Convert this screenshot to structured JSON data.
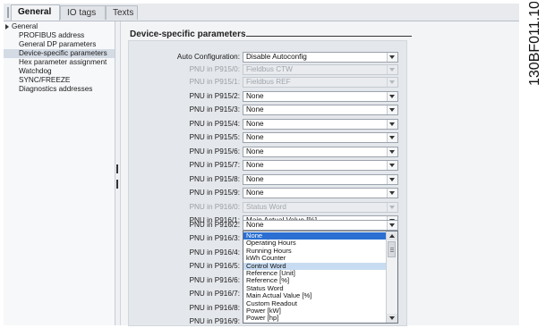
{
  "tabs": [
    {
      "label": "General",
      "active": true
    },
    {
      "label": "IO tags",
      "active": false
    },
    {
      "label": "Texts",
      "active": false
    }
  ],
  "nav": {
    "items": [
      {
        "label": "General",
        "root": true,
        "selected": false
      },
      {
        "label": "PROFIBUS address",
        "root": false,
        "selected": false
      },
      {
        "label": "General DP parameters",
        "root": false,
        "selected": false
      },
      {
        "label": "Device-specific parameters",
        "root": false,
        "selected": true
      },
      {
        "label": "Hex parameter assignment",
        "root": false,
        "selected": false
      },
      {
        "label": "Watchdog",
        "root": false,
        "selected": false
      },
      {
        "label": "SYNC/FREEZE",
        "root": false,
        "selected": false
      },
      {
        "label": "Diagnostics addresses",
        "root": false,
        "selected": false
      }
    ]
  },
  "section": {
    "title": "Device-specific parameters"
  },
  "rows": [
    {
      "label": "Auto Configuration:",
      "value": "Disable Autoconfig",
      "disabled": false
    },
    {
      "label": "PNU in P915/0:",
      "value": "Fieldbus CTW",
      "disabled": true
    },
    {
      "label": "PNU in P915/1:",
      "value": "Fieldbus REF",
      "disabled": true
    },
    {
      "label": "PNU in P915/2:",
      "value": "None",
      "disabled": false
    },
    {
      "label": "PNU in P915/3:",
      "value": "None",
      "disabled": false
    },
    {
      "label": "PNU in P915/4:",
      "value": "None",
      "disabled": false
    },
    {
      "label": "PNU in P915/5:",
      "value": "None",
      "disabled": false
    },
    {
      "label": "PNU in P915/6:",
      "value": "None",
      "disabled": false
    },
    {
      "label": "PNU in P915/7:",
      "value": "None",
      "disabled": false
    },
    {
      "label": "PNU in P915/8:",
      "value": "None",
      "disabled": false
    },
    {
      "label": "PNU in P915/9:",
      "value": "None",
      "disabled": false
    },
    {
      "label": "PNU in P916/0:",
      "value": "Status Word",
      "disabled": true
    },
    {
      "label": "PNU in P916/1:",
      "value": "Main Actual Value [%]",
      "disabled": false
    },
    {
      "label": "PNU in P916/2:",
      "value": "None",
      "disabled": false
    }
  ],
  "hidden_rows": [
    {
      "label": "PNU in P916/3:"
    },
    {
      "label": "PNU in P916/4:"
    },
    {
      "label": "PNU in P916/5:"
    },
    {
      "label": "PNU in P916/6:"
    },
    {
      "label": "PNU in P916/7:"
    },
    {
      "label": "PNU in P916/8:"
    },
    {
      "label": "PNU in P916/9:"
    }
  ],
  "dropdown": {
    "options": [
      {
        "label": "None",
        "state": "selected"
      },
      {
        "label": "Operating Hours",
        "state": ""
      },
      {
        "label": "Running Hours",
        "state": ""
      },
      {
        "label": "kWh Counter",
        "state": ""
      },
      {
        "label": "Control Word",
        "state": "highlight"
      },
      {
        "label": "Reference [Unit]",
        "state": ""
      },
      {
        "label": "Reference [%]",
        "state": ""
      },
      {
        "label": "Status Word",
        "state": ""
      },
      {
        "label": "Main Actual Value [%]",
        "state": ""
      },
      {
        "label": "Custom Readout",
        "state": ""
      },
      {
        "label": "Power [kW]",
        "state": ""
      },
      {
        "label": "Power [hp]",
        "state": ""
      }
    ]
  },
  "figure_id": "130BF011.10"
}
